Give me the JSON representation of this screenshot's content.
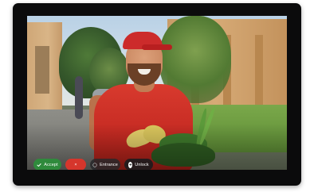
{
  "call_screen": {
    "accept_label": "Accept",
    "decline_label": "×",
    "entrance_label": "Entrance",
    "unlock_label": "Unlock",
    "accept_icon": "checkmark-icon",
    "entrance_icon": "door-icon",
    "unlock_icon": "lock-icon"
  },
  "colors": {
    "accept": "#2f8a3c",
    "decline": "#d6362c",
    "device_frame": "#0b0b0c"
  }
}
